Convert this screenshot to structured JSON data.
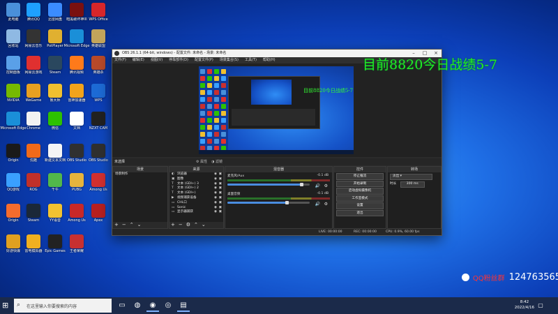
{
  "desktop": {
    "icons": [
      {
        "label": "此电脑",
        "color": "#4a90d9"
      },
      {
        "label": "腾讯QQ",
        "color": "#1ea0ff"
      },
      {
        "label": "迅雷网盘",
        "color": "#3b8cff"
      },
      {
        "label": "暗黑破坏神III",
        "color": "#7a1010"
      },
      {
        "label": "WPS Office",
        "color": "#d6262a"
      },
      {
        "label": "回收站",
        "color": "#8fb9e3"
      },
      {
        "label": "网易云音乐",
        "color": "#333333"
      },
      {
        "label": "PotPlayer",
        "color": "#e0b030"
      },
      {
        "label": "Microsoft Edge",
        "color": "#1a8fd8"
      },
      {
        "label": "英雄联盟",
        "color": "#c2a45b"
      },
      {
        "label": "控制面板",
        "color": "#5aa0e8"
      },
      {
        "label": "网易云游戏",
        "color": "#e03030"
      },
      {
        "label": "Steam",
        "color": "#2a475e"
      },
      {
        "label": "腾讯视频",
        "color": "#ff7a1a"
      },
      {
        "label": "英雄杀",
        "color": "#b84a2a"
      },
      {
        "label": "NVIDIA",
        "color": "#76b900"
      },
      {
        "label": "WeGame",
        "color": "#e8a020"
      },
      {
        "label": "鲁大师",
        "color": "#f0c030"
      },
      {
        "label": "雷神加速器",
        "color": "#f2a31b"
      },
      {
        "label": "WPS",
        "color": "#1d6bd6"
      },
      {
        "label": "Microsoft Edge",
        "color": "#1a8fd8"
      },
      {
        "label": "Chrome",
        "color": "#f2f2f2"
      },
      {
        "label": "微信",
        "color": "#2dc100"
      },
      {
        "label": "文档",
        "color": "#ffffff"
      },
      {
        "label": "NZXT CAM",
        "color": "#222222"
      },
      {
        "label": "Origin",
        "color": "#1a1a1a"
      },
      {
        "label": "优酷",
        "color": "#f06a1a"
      },
      {
        "label": "新建文本文档",
        "color": "#f5f5f5"
      },
      {
        "label": "OBS Studio",
        "color": "#303030"
      },
      {
        "label": "OBS Studio",
        "color": "#303030"
      },
      {
        "label": "QQ游戏",
        "color": "#3aa0ff"
      },
      {
        "label": "ROG",
        "color": "#c0302a"
      },
      {
        "label": "千牛",
        "color": "#52b84a"
      },
      {
        "label": "PUBG",
        "color": "#e6b43c"
      },
      {
        "label": "Among Us",
        "color": "#d23030"
      },
      {
        "label": "Origin",
        "color": "#f56c2d"
      },
      {
        "label": "Steam",
        "color": "#1b2838"
      },
      {
        "label": "YY语音",
        "color": "#f2c230"
      },
      {
        "label": "Among Us",
        "color": "#c82828"
      },
      {
        "label": "Apex",
        "color": "#b82020"
      },
      {
        "label": "好游快爆",
        "color": "#e0a020"
      },
      {
        "label": "雷电模拟器",
        "color": "#f0b020"
      },
      {
        "label": "Epic Games",
        "color": "#222222"
      },
      {
        "label": "王者荣耀",
        "color": "#c83030"
      }
    ]
  },
  "obs": {
    "title": "OBS 26.1.1 (64-bit, windows) - 配置文件: 未命名 - 场景: 未命名",
    "menu": [
      "文件(F)",
      "编辑(E)",
      "视图(V)",
      "停靠部件(D)",
      "配置文件(P)",
      "场景集合(S)",
      "工具(T)",
      "帮助(H)"
    ],
    "scene_label": "未选择",
    "props_btn": "属性",
    "filter_btn": "滤镜",
    "docks": {
      "scenes": {
        "header": "场景",
        "items": [
          "场景制作"
        ]
      },
      "sources": {
        "header": "来源",
        "items": [
          {
            "icon": "◐",
            "label": "浏览器"
          },
          {
            "icon": "▣",
            "label": "图像"
          },
          {
            "icon": "T",
            "label": "文本 (GDI+) 3"
          },
          {
            "icon": "T",
            "label": "文本 (GDI+) 2"
          },
          {
            "icon": "T",
            "label": "文本 (GDI+)"
          },
          {
            "icon": "▶",
            "label": "视频捕获设备"
          },
          {
            "icon": "▭",
            "label": "CHL口"
          },
          {
            "icon": "▭",
            "label": "Sonic"
          },
          {
            "icon": "▭",
            "label": "显示器捕获"
          }
        ]
      },
      "mixer": {
        "header": "混音器",
        "channels": [
          {
            "name": "麦克风/Aux",
            "db": "-0.1 dB",
            "fill": 0.9
          },
          {
            "name": "桌面音频",
            "db": "-0.1 dB",
            "fill": 0.72
          }
        ]
      },
      "transitions": {
        "header": "转场",
        "label": "淡出",
        "duration_label": "时长",
        "duration_value": "300 ms"
      },
      "controls": {
        "header": "控件",
        "buttons": [
          "停止推流",
          "开始录制",
          "启动虚拟摄像机",
          "工作室模式",
          "设置",
          "退出"
        ]
      }
    },
    "status": {
      "live": "LIVE: 00:00:00",
      "rec": "REC: 00:00:00",
      "cpu": "CPU: 0.9%, 60.00 fps"
    },
    "preview_overlay": "目前8820今日战绩5-7"
  },
  "overlay_text": "目前8820今日战绩5-7",
  "qq": {
    "label": "QQ粉丝群",
    "number": "124763565"
  },
  "taskbar": {
    "search_placeholder": "在这里输入你要搜索的内容",
    "time": "8:42",
    "date": "2022/4/16"
  }
}
